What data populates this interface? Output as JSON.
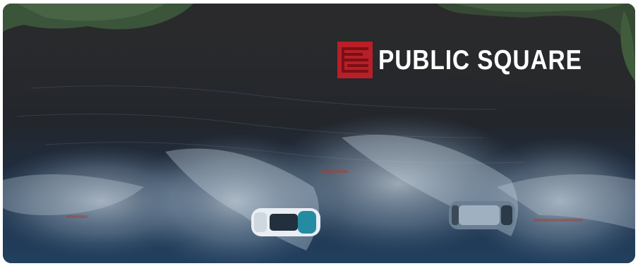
{
  "brand": {
    "name": "PUBLIC SQUARE",
    "logo_icon": "ps-square-logo-icon",
    "logo_color": "#b81f27",
    "text_color": "#ffffff"
  },
  "scene": {
    "water_color": "#1f3552",
    "foliage_color": "#5c9a55",
    "vehicle_colors": [
      "#e8eef3",
      "#6a7f93"
    ]
  }
}
